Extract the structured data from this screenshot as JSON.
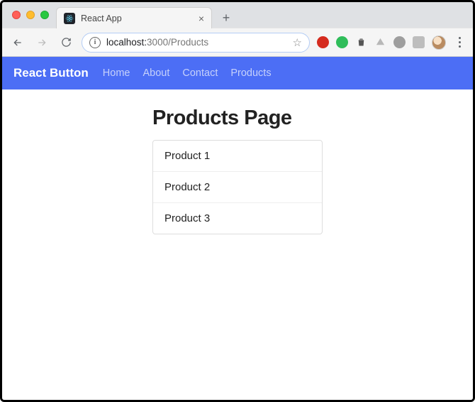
{
  "browser": {
    "tab_title": "React App",
    "url_host": "localhost:",
    "url_rest": "3000/Products"
  },
  "navbar": {
    "brand": "React Button",
    "links": [
      "Home",
      "About",
      "Contact",
      "Products"
    ]
  },
  "page": {
    "title": "Products Page",
    "items": [
      "Product 1",
      "Product 2",
      "Product 3"
    ]
  }
}
